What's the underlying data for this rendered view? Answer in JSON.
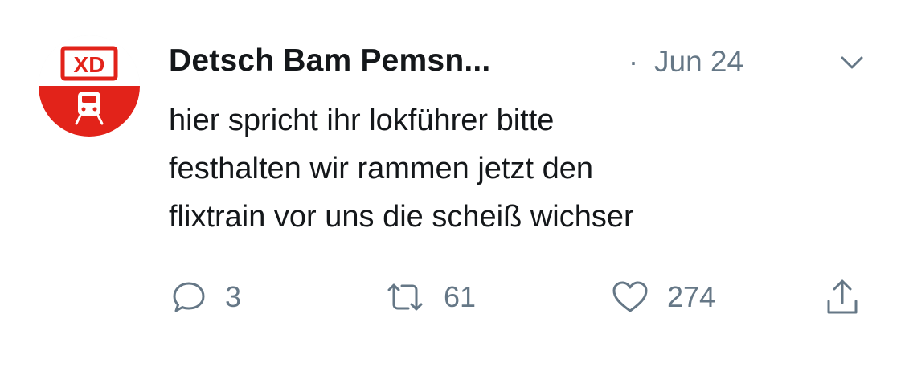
{
  "tweet": {
    "avatar": {
      "logo_text": "XD",
      "icon": "train-front-icon",
      "colors": {
        "red": "#e2231a",
        "white": "#ffffff"
      }
    },
    "display_name": "Detsch Bam Pemsn...",
    "separator": "·",
    "date": "Jun 24",
    "caret_icon": "chevron-down-icon",
    "text_lines": [
      "hier spricht ihr lokführer bitte",
      "festhalten wir rammen jetzt den",
      "flixtrain vor uns die scheiß wichser"
    ],
    "actions": {
      "reply": {
        "icon": "reply-icon",
        "count": "3"
      },
      "retweet": {
        "icon": "retweet-icon",
        "count": "61"
      },
      "like": {
        "icon": "heart-icon",
        "count": "274"
      },
      "share": {
        "icon": "share-icon"
      }
    },
    "colors": {
      "text": "#14171a",
      "muted": "#657786"
    }
  }
}
